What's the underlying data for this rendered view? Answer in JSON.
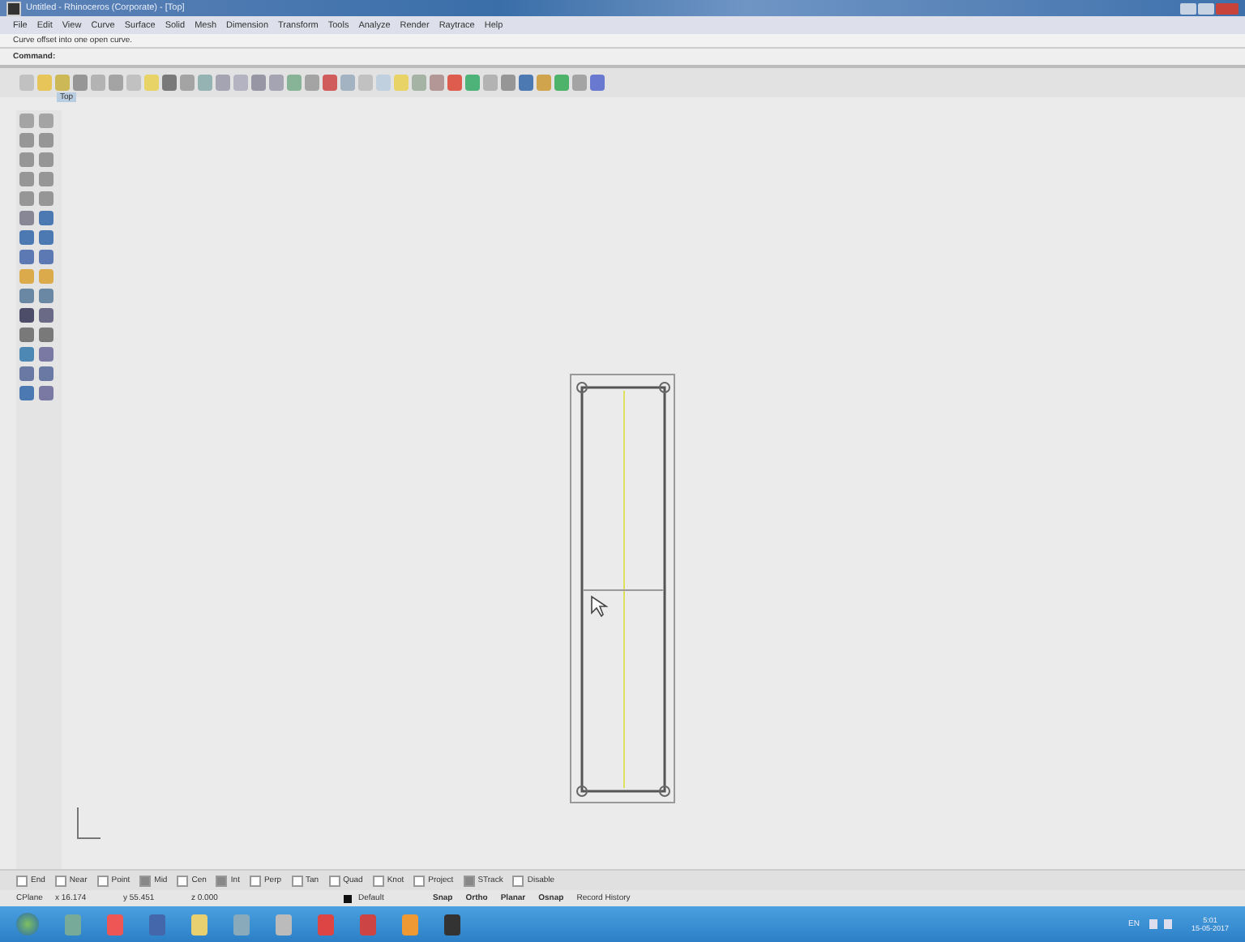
{
  "window": {
    "title": "Untitled - Rhinoceros (Corporate) - [Top]"
  },
  "menu": [
    "File",
    "Edit",
    "View",
    "Curve",
    "Surface",
    "Solid",
    "Mesh",
    "Dimension",
    "Transform",
    "Tools",
    "Analyze",
    "Render",
    "Raytrace",
    "Help"
  ],
  "command_history": "Curve offset into one open curve.",
  "command_prompt": "Command:",
  "viewport": {
    "tab": "Top"
  },
  "osnaps": [
    {
      "label": "End",
      "checked": false
    },
    {
      "label": "Near",
      "checked": false
    },
    {
      "label": "Point",
      "checked": false
    },
    {
      "label": "Mid",
      "checked": true
    },
    {
      "label": "Cen",
      "checked": false
    },
    {
      "label": "Int",
      "checked": true
    },
    {
      "label": "Perp",
      "checked": false
    },
    {
      "label": "Tan",
      "checked": false
    },
    {
      "label": "Quad",
      "checked": false
    },
    {
      "label": "Knot",
      "checked": false
    },
    {
      "label": "Project",
      "checked": false
    },
    {
      "label": "STrack",
      "checked": true
    },
    {
      "label": "Disable",
      "checked": false
    }
  ],
  "status_bar": {
    "cplane": "CPlane",
    "x": "x 16.174",
    "y": "y 55.451",
    "z": "z 0.000",
    "layer": "Default",
    "toggles": [
      "Snap",
      "Ortho",
      "Planar",
      "Osnap",
      "Record History"
    ]
  },
  "taskbar": {
    "language": "EN",
    "time": "5:01",
    "date": "15-05-2017"
  }
}
